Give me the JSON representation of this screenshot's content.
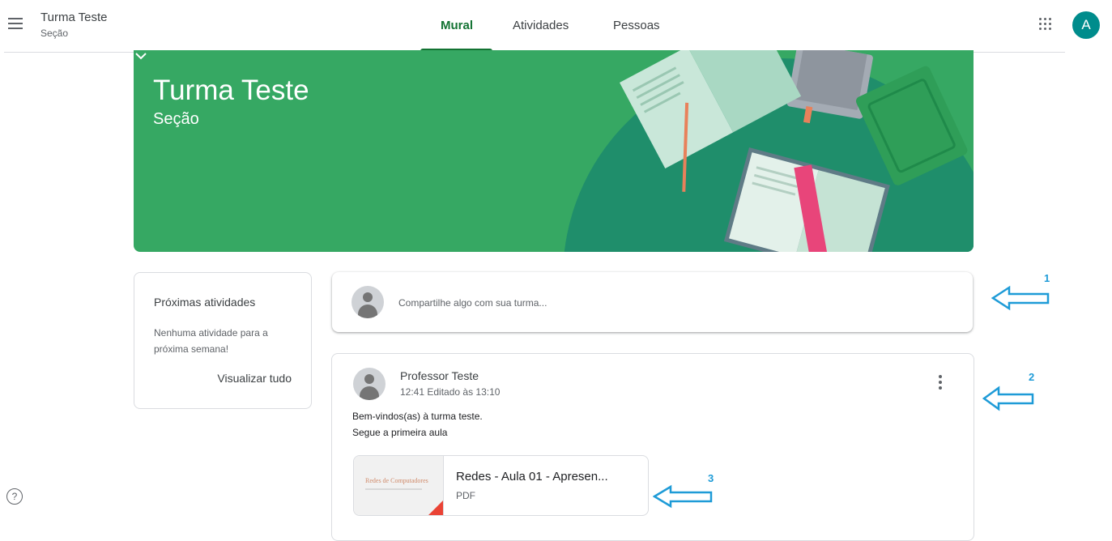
{
  "header": {
    "class_name": "Turma Teste",
    "class_section": "Seção",
    "tabs": [
      {
        "label": "Mural",
        "active": true
      },
      {
        "label": "Atividades",
        "active": false
      },
      {
        "label": "Pessoas",
        "active": false
      }
    ],
    "account_initial": "A",
    "accent_color": "#137333",
    "avatar_color": "#008c8c"
  },
  "banner": {
    "title": "Turma Teste",
    "subtitle": "Seção",
    "background_color": "#36a863"
  },
  "upcoming": {
    "title": "Próximas atividades",
    "text": "Nenhuma atividade para a próxima semana!",
    "link": "Visualizar tudo"
  },
  "share": {
    "placeholder": "Compartilhe algo com sua turma..."
  },
  "post": {
    "author": "Professor Teste",
    "time": "12:41 Editado às 13:10",
    "lines": [
      "Bem-vindos(as) à turma teste.",
      "Segue a primeira aula"
    ],
    "attachment": {
      "title": "Redes - Aula 01 - Apresen...",
      "type": "PDF",
      "thumbnail_text": "Redes de Computadores"
    }
  },
  "annotations": [
    {
      "number": "1"
    },
    {
      "number": "2"
    },
    {
      "number": "3"
    }
  ],
  "annotation_color": "#1e9bd7",
  "help": {
    "icon": "help-circle-icon",
    "glyph": "?"
  }
}
